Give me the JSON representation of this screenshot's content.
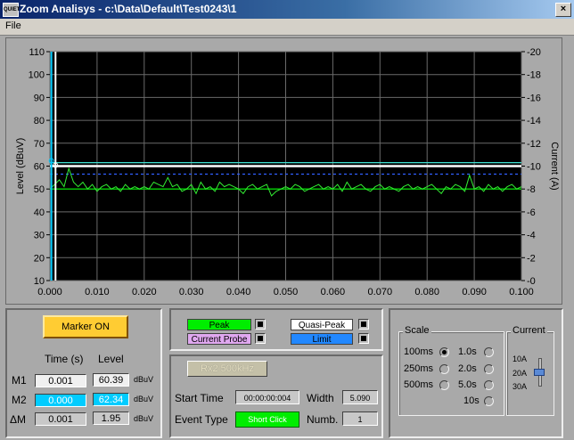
{
  "window": {
    "title": "Zoom Analisys - c:\\Data\\Default\\Test0243\\1",
    "icon_text": "QUIET",
    "close_glyph": "×"
  },
  "menu": {
    "file": "File"
  },
  "chart_data": {
    "type": "line",
    "xlabel": "",
    "ylabel": "Level (dBuV)",
    "y2label": "Current (A)",
    "xlim": [
      0,
      0.1
    ],
    "ylim": [
      10,
      110
    ],
    "y2lim": [
      0,
      20
    ],
    "x_ticks": [
      "0.000",
      "0.010",
      "0.020",
      "0.030",
      "0.040",
      "0.050",
      "0.060",
      "0.070",
      "0.080",
      "0.090",
      "0.100"
    ],
    "y_ticks": [
      "110",
      "100",
      "90",
      "80",
      "70",
      "60",
      "50",
      "40",
      "30",
      "20",
      "10"
    ],
    "y2_ticks": [
      "-20",
      "-18",
      "-16",
      "-14",
      "-12",
      "-10",
      "-8",
      "-6",
      "-4",
      "-2",
      "-0"
    ],
    "grid": true,
    "reference_lines": [
      {
        "kind": "horizontal",
        "y": 61.5,
        "color": "#40e0d0"
      },
      {
        "kind": "horizontal",
        "y": 60.0,
        "color": "#ffffff"
      },
      {
        "kind": "horizontal",
        "y": 56.5,
        "color": "#3060ff",
        "style": "dashed"
      },
      {
        "kind": "horizontal",
        "y": 50.0,
        "color": "#00d000"
      }
    ],
    "markers": [
      {
        "x": 0.001,
        "y": 60.39,
        "color": "#ffffff"
      },
      {
        "x": 0.0005,
        "y": 62.34,
        "color": "#00ccff"
      }
    ],
    "series": [
      {
        "color": "#33ee33",
        "x": [
          0.0,
          0.001,
          0.002,
          0.003,
          0.004,
          0.005,
          0.006,
          0.007,
          0.008,
          0.009,
          0.01,
          0.011,
          0.012,
          0.013,
          0.014,
          0.015,
          0.016,
          0.017,
          0.018,
          0.019,
          0.02,
          0.021,
          0.022,
          0.023,
          0.024,
          0.025,
          0.026,
          0.027,
          0.028,
          0.029,
          0.03,
          0.031,
          0.032,
          0.033,
          0.034,
          0.035,
          0.036,
          0.037,
          0.038,
          0.039,
          0.04,
          0.041,
          0.042,
          0.043,
          0.044,
          0.045,
          0.046,
          0.047,
          0.048,
          0.049,
          0.05,
          0.051,
          0.052,
          0.053,
          0.054,
          0.055,
          0.056,
          0.057,
          0.058,
          0.059,
          0.06,
          0.061,
          0.062,
          0.063,
          0.064,
          0.065,
          0.066,
          0.067,
          0.068,
          0.069,
          0.07,
          0.071,
          0.072,
          0.073,
          0.074,
          0.075,
          0.076,
          0.077,
          0.078,
          0.079,
          0.08,
          0.081,
          0.082,
          0.083,
          0.084,
          0.085,
          0.086,
          0.087,
          0.088,
          0.089,
          0.09,
          0.091,
          0.092,
          0.093,
          0.094,
          0.095,
          0.096,
          0.097,
          0.098,
          0.099,
          0.1
        ],
        "y": [
          50,
          52,
          54,
          51,
          59,
          53,
          51,
          53,
          50,
          52,
          49,
          51,
          52,
          50,
          51,
          49,
          52,
          50,
          51,
          50,
          51,
          50,
          53,
          52,
          51,
          55,
          51,
          52,
          49,
          50,
          52,
          48,
          53,
          50,
          51,
          49,
          53,
          51,
          52,
          51,
          50,
          48,
          51,
          52,
          50,
          51,
          52,
          47,
          49,
          50,
          51,
          50,
          52,
          51,
          49,
          50,
          51,
          52,
          50,
          51,
          50,
          52,
          49,
          53,
          50,
          51,
          52,
          50,
          49,
          51,
          52,
          50,
          51,
          50,
          49,
          51,
          52,
          50,
          51,
          50,
          51,
          52,
          50,
          48,
          51,
          50,
          52,
          51,
          49,
          56,
          50,
          51,
          49,
          52,
          50,
          51,
          49,
          51,
          52,
          50,
          51
        ]
      }
    ]
  },
  "marker_panel": {
    "marker_button": "Marker ON",
    "col_time": "Time (s)",
    "col_level": "Level",
    "rows": [
      {
        "label": "M1",
        "time": "0.001",
        "level": "60.39",
        "unit": "dBuV"
      },
      {
        "label": "M2",
        "time": "0.000",
        "level": "62.34",
        "unit": "dBuV"
      },
      {
        "label": "ΔM",
        "time": "0.001",
        "level": "1.95",
        "unit": "dBuV"
      }
    ]
  },
  "legend": {
    "peak": "Peak",
    "current_probe": "Current Probe",
    "quasi_peak": "Quasi-Peak",
    "limit": "Limit",
    "colors": {
      "peak": "#00ee00",
      "current_probe": "#e0a8f0",
      "quasi_peak": "#ffffff",
      "limit": "#2288ff"
    }
  },
  "event_panel": {
    "rx_button": "Rx2 500kHz",
    "start_time_label": "Start Time",
    "start_time": "00:00:00:004",
    "width_label": "Width",
    "width": "5.090",
    "event_type_label": "Event Type",
    "event_type": "Short Click",
    "numb_label": "Numb.",
    "numb": "1"
  },
  "scale": {
    "title": "Scale",
    "options": [
      {
        "label": "100ms",
        "selected": true
      },
      {
        "label": "250ms",
        "selected": false
      },
      {
        "label": "500ms",
        "selected": false
      },
      {
        "label": "1.0s",
        "selected": false
      },
      {
        "label": "2.0s",
        "selected": false
      },
      {
        "label": "5.0s",
        "selected": false
      },
      {
        "label": "10s",
        "selected": false
      }
    ]
  },
  "current": {
    "title": "Current",
    "levels": [
      "10A",
      "20A",
      "30A"
    ],
    "selected": "20A"
  }
}
